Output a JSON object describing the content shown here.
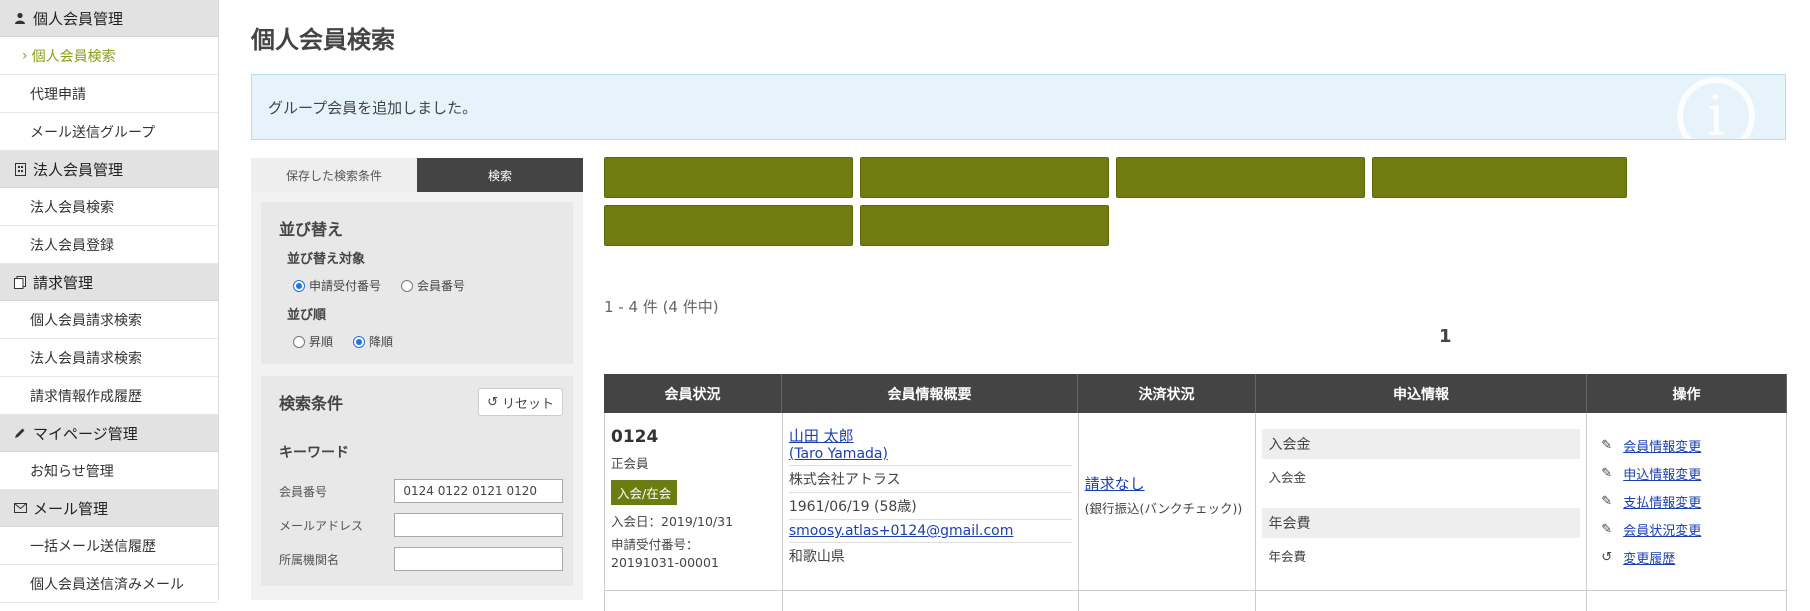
{
  "sidebar": {
    "sections": [
      {
        "title": "個人会員管理",
        "icon": "person-icon",
        "items": [
          "個人会員検索",
          "代理申請",
          "メール送信グループ"
        ]
      },
      {
        "title": "法人会員管理",
        "icon": "building-icon",
        "items": [
          "法人会員検索",
          "法人会員登録"
        ]
      },
      {
        "title": "請求管理",
        "icon": "copy-icon",
        "items": [
          "個人会員請求検索",
          "法人会員請求検索",
          "請求情報作成履歴"
        ]
      },
      {
        "title": "マイページ管理",
        "icon": "pencil-icon",
        "items": [
          "お知らせ管理"
        ]
      },
      {
        "title": "メール管理",
        "icon": "envelope-icon",
        "items": [
          "一括メール送信履歴",
          "個人会員送信済みメール"
        ]
      }
    ],
    "active_item": "個人会員検索"
  },
  "page": {
    "title": "個人会員検索",
    "alert": "グループ会員を追加しました。"
  },
  "search_panel": {
    "tab_saved": "保存した検索条件",
    "tab_search": "検索",
    "sort": {
      "heading": "並び替え",
      "target_label": "並び替え対象",
      "target_options": [
        "申請受付番号",
        "会員番号"
      ],
      "target_selected": "申請受付番号",
      "order_label": "並び順",
      "order_options": [
        "昇順",
        "降順"
      ],
      "order_selected": "降順"
    },
    "conditions": {
      "heading": "検索条件",
      "reset_label": "リセット",
      "keyword_label": "キーワード",
      "fields": [
        {
          "label": "会員番号",
          "value": "0124 0122 0121 0120"
        },
        {
          "label": "メールアドレス",
          "value": ""
        },
        {
          "label": "所属機関名",
          "value": ""
        }
      ]
    }
  },
  "results": {
    "count_text": "1 - 4 件 (4 件中)",
    "current_page": "1",
    "filter_color": "#717c10"
  },
  "table": {
    "headers": [
      "会員状況",
      "会員情報概要",
      "決済状況",
      "申込情報",
      "操作"
    ],
    "rows": [
      {
        "member_no": "0124",
        "member_type": "正会員",
        "status_badge": "入会/在会",
        "join_date": "入会日：2019/10/31",
        "app_no_label": "申請受付番号：",
        "app_no": "20191031-00001",
        "name": "山田 太郎",
        "name_en": "(Taro Yamada)",
        "company": "株式会社アトラス",
        "birth": "1961/06/19 (58歳)",
        "email": "smoosy.atlas+0124@gmail.com",
        "pref": "和歌山県",
        "payment_status": "請求なし",
        "payment_method": "(銀行振込(バンクチェック))",
        "fee1_title": "入会金",
        "fee1_sub": "入会金",
        "fee2_title": "年会費",
        "fee2_sub": "年会費",
        "ops": [
          "会員情報変更",
          "申込情報変更",
          "支払情報変更",
          "会員状況変更",
          "変更履歴"
        ]
      }
    ]
  }
}
